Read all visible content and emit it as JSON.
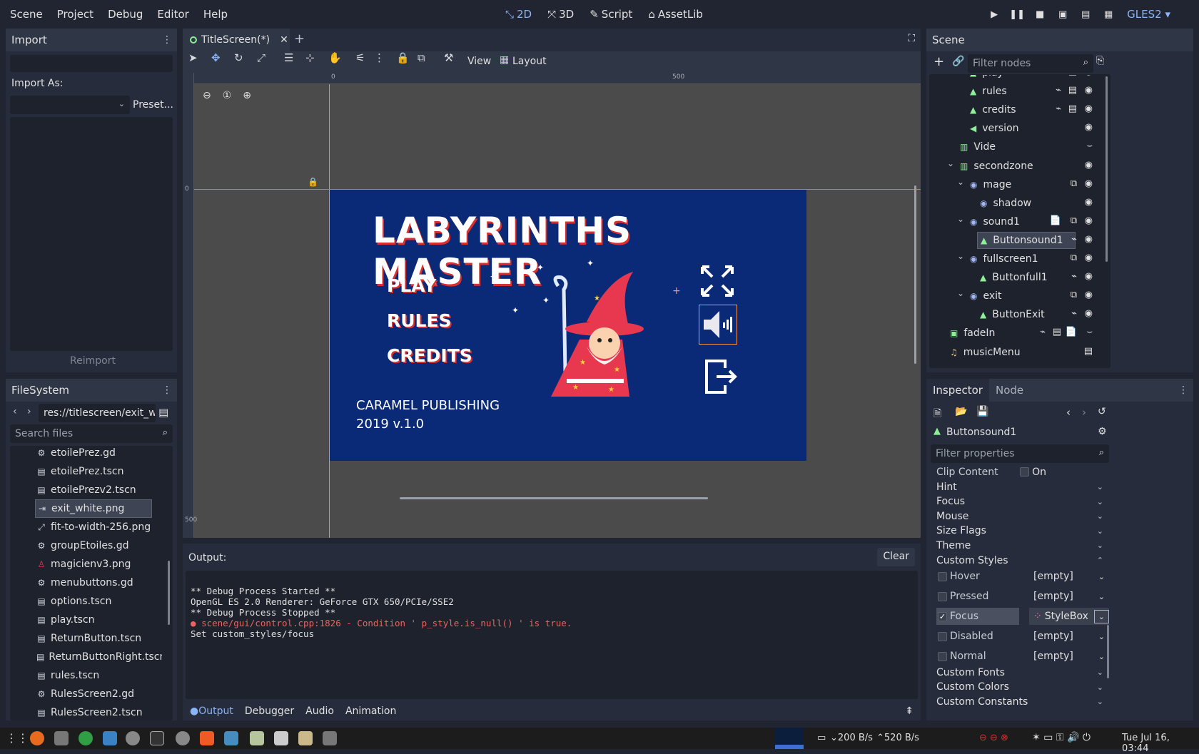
{
  "menubar": {
    "items": [
      "Scene",
      "Project",
      "Debug",
      "Editor",
      "Help"
    ]
  },
  "modes": {
    "items": [
      {
        "icon": "2d-icon",
        "label": "2D"
      },
      {
        "icon": "3d-icon",
        "label": "3D"
      },
      {
        "icon": "script-icon",
        "label": "Script"
      },
      {
        "icon": "assetlib-icon",
        "label": "AssetLib"
      }
    ]
  },
  "renderer": "GLES2",
  "import_panel": {
    "title": "Import",
    "import_as_label": "Import As:",
    "preset_label": "Preset...",
    "reimport_label": "Reimport"
  },
  "filesystem": {
    "title": "FileSystem",
    "path": "res://titlescreen/exit_w",
    "search_placeholder": "Search files",
    "files": [
      {
        "name": "etoilePrez.gd",
        "icon": "gear-icon",
        "selected": false
      },
      {
        "name": "etoilePrez.tscn",
        "icon": "clapper-icon",
        "selected": false
      },
      {
        "name": "etoilePrezv2.tscn",
        "icon": "clapper-icon",
        "selected": false
      },
      {
        "name": "exit_white.png",
        "icon": "exit-icon",
        "selected": true
      },
      {
        "name": "fit-to-width-256.png",
        "icon": "fit-icon",
        "selected": false
      },
      {
        "name": "groupEtoiles.gd",
        "icon": "gear-icon",
        "selected": false
      },
      {
        "name": "magicienv3.png",
        "icon": "wizard-icon",
        "selected": false
      },
      {
        "name": "menubuttons.gd",
        "icon": "gear-icon",
        "selected": false
      },
      {
        "name": "options.tscn",
        "icon": "clapper-icon",
        "selected": false
      },
      {
        "name": "play.tscn",
        "icon": "clapper-icon",
        "selected": false
      },
      {
        "name": "ReturnButton.tscn",
        "icon": "clapper-icon",
        "selected": false
      },
      {
        "name": "ReturnButtonRight.tscn",
        "icon": "clapper-icon",
        "selected": false
      },
      {
        "name": "rules.tscn",
        "icon": "clapper-icon",
        "selected": false
      },
      {
        "name": "RulesScreen2.gd",
        "icon": "gear-icon",
        "selected": false
      },
      {
        "name": "RulesScreen2.tscn",
        "icon": "clapper-icon",
        "selected": false
      }
    ]
  },
  "editor_tab": {
    "title": "TitleScreen(*)"
  },
  "viewport_toolbar": {
    "view_label": "View",
    "layout_label": "Layout"
  },
  "ruler": {
    "mark_0": "0",
    "mark_500": "500",
    "vmark_0": "0",
    "vmark_500": "500"
  },
  "game": {
    "title": "LABYRINTHS MASTER",
    "menu": [
      "PLAY",
      "RULES",
      "CREDITS"
    ],
    "publisher": "CARAMEL PUBLISHING",
    "version": "2019 v.1.0"
  },
  "output": {
    "title": "Output:",
    "clear_label": "Clear",
    "lines": [
      {
        "text": "** Debug Process Started **",
        "error": false
      },
      {
        "text": "OpenGL ES 2.0 Renderer: GeForce GTX 650/PCIe/SSE2",
        "error": false
      },
      {
        "text": "** Debug Process Stopped **",
        "error": false
      },
      {
        "text": "scene/gui/control.cpp:1826 - Condition ' p_style.is_null() ' is true.",
        "error": true
      },
      {
        "text": "Set custom_styles/focus",
        "error": false
      }
    ]
  },
  "bottom_tabs": [
    "Output",
    "Debugger",
    "Audio",
    "Animation"
  ],
  "scene_panel": {
    "title": "Scene",
    "filter_placeholder": "Filter nodes",
    "nodes": [
      {
        "name": "play",
        "depth": 3,
        "type": "button",
        "icons": [
          "signal",
          "clapper",
          "eye"
        ]
      },
      {
        "name": "rules",
        "depth": 3,
        "type": "button",
        "icons": [
          "signal",
          "clapper",
          "eye"
        ]
      },
      {
        "name": "credits",
        "depth": 3,
        "type": "button",
        "icons": [
          "signal",
          "clapper",
          "eye"
        ]
      },
      {
        "name": "version",
        "depth": 3,
        "type": "label",
        "icons": [
          "eye"
        ]
      },
      {
        "name": "Vide",
        "depth": 2,
        "type": "container",
        "icons": [
          "eye-closed"
        ]
      },
      {
        "name": "secondzone",
        "depth": 2,
        "type": "container",
        "icons": [
          "eye"
        ],
        "expanded": true
      },
      {
        "name": "mage",
        "depth": 3,
        "type": "control",
        "icons": [
          "group",
          "eye"
        ],
        "expanded": true
      },
      {
        "name": "shadow",
        "depth": 4,
        "type": "control",
        "icons": [
          "eye"
        ]
      },
      {
        "name": "sound1",
        "depth": 3,
        "type": "control",
        "icons": [
          "script",
          "group",
          "eye"
        ],
        "expanded": true
      },
      {
        "name": "Buttonsound1",
        "depth": 4,
        "type": "button",
        "icons": [
          "signal",
          "eye"
        ],
        "selected": true
      },
      {
        "name": "fullscreen1",
        "depth": 3,
        "type": "control",
        "icons": [
          "group",
          "eye"
        ],
        "expanded": true
      },
      {
        "name": "Buttonfull1",
        "depth": 4,
        "type": "button",
        "icons": [
          "signal",
          "eye"
        ]
      },
      {
        "name": "exit",
        "depth": 3,
        "type": "control",
        "icons": [
          "group",
          "eye"
        ],
        "expanded": true
      },
      {
        "name": "ButtonExit",
        "depth": 4,
        "type": "button",
        "icons": [
          "signal",
          "eye"
        ]
      },
      {
        "name": "fadeIn",
        "depth": 1,
        "type": "rect",
        "icons": [
          "signal",
          "clapper",
          "script",
          "eye-closed"
        ]
      },
      {
        "name": "musicMenu",
        "depth": 1,
        "type": "audio",
        "icons": [
          "clapper"
        ]
      }
    ]
  },
  "inspector": {
    "tabs": [
      "Inspector",
      "Node"
    ],
    "selected_node": "Buttonsound1",
    "filter_placeholder": "Filter properties",
    "clip_content": {
      "label": "Clip Content",
      "value": "On"
    },
    "sections": [
      "Hint",
      "Focus",
      "Mouse",
      "Size Flags",
      "Theme",
      "Custom Styles"
    ],
    "custom_styles": [
      {
        "label": "Hover",
        "value": "[empty]",
        "checked": false
      },
      {
        "label": "Pressed",
        "value": "[empty]",
        "checked": false
      },
      {
        "label": "Focus",
        "value": "StyleBox",
        "checked": true
      },
      {
        "label": "Disabled",
        "value": "[empty]",
        "checked": false
      },
      {
        "label": "Normal",
        "value": "[empty]",
        "checked": false
      }
    ],
    "more_sections": [
      "Custom Fonts",
      "Custom Colors",
      "Custom Constants"
    ]
  },
  "taskbar": {
    "net_down": "200 B/s",
    "net_up": "520 B/s",
    "clock": "Tue Jul 16, 03:44"
  },
  "colors": {
    "accent": "#8ab4f8",
    "game_bg": "#0a2a78",
    "error": "#f06161",
    "node_green": "#8eef97",
    "node_blue": "#a5b7f3"
  }
}
